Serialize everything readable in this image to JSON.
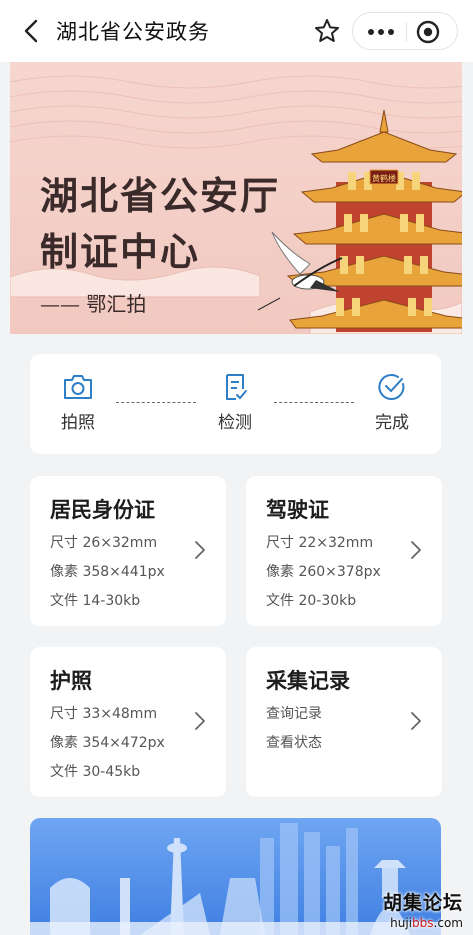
{
  "header": {
    "title": "湖北省公安政务"
  },
  "banner": {
    "title_line1": "湖北省公安厅",
    "title_line2": "制证中心",
    "subtitle": "—— 鄂汇拍",
    "tower_plaque": "黄鹤楼"
  },
  "steps": [
    {
      "label": "拍照",
      "icon": "camera-icon"
    },
    {
      "label": "检测",
      "icon": "document-check-icon"
    },
    {
      "label": "完成",
      "icon": "check-circle-icon"
    }
  ],
  "cards": {
    "id_card": {
      "title": "居民身份证",
      "size": "尺寸 26×32mm",
      "pixels": "像素 358×441px",
      "file": "文件 14-30kb"
    },
    "driver_license": {
      "title": "驾驶证",
      "size": "尺寸 22×32mm",
      "pixels": "像素 260×378px",
      "file": "文件 20-30kb"
    },
    "passport": {
      "title": "护照",
      "size": "尺寸 33×48mm",
      "pixels": "像素 354×472px",
      "file": "文件 30-45kb"
    },
    "records": {
      "title": "采集记录",
      "query": "查询记录",
      "status": "查看状态"
    }
  },
  "watermark": {
    "name": "胡集论坛",
    "url_prefix": "huji",
    "url_accent": "bbs",
    "url_suffix": ".com"
  },
  "colors": {
    "accent": "#2f7fc8",
    "banner_pink": "#f3cfc7",
    "city_blue": "#4a8ae6"
  }
}
